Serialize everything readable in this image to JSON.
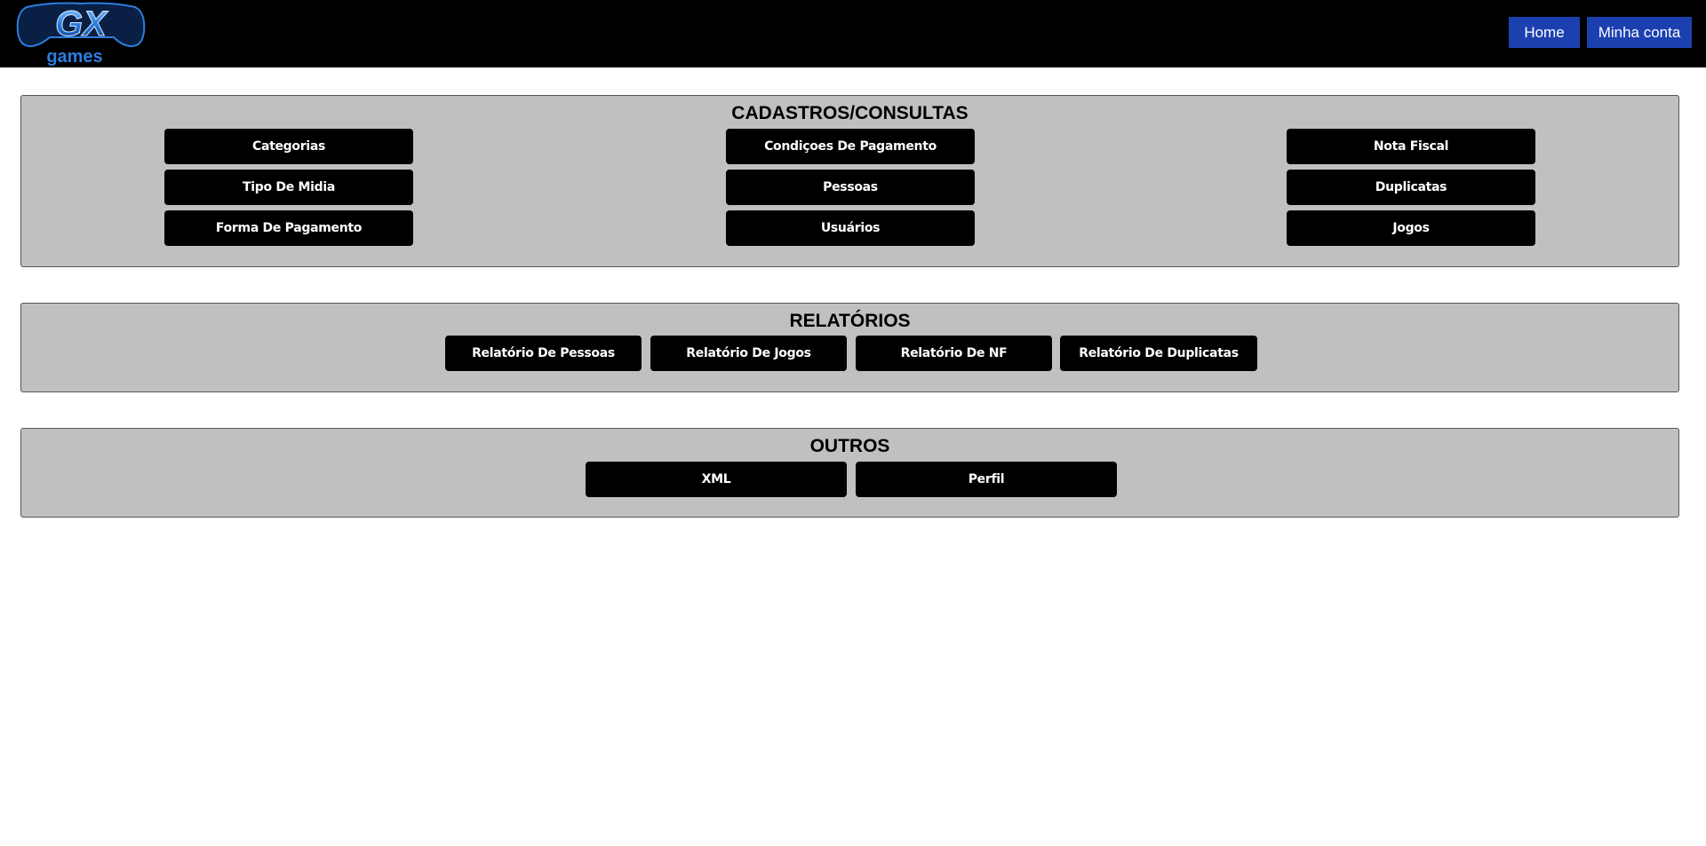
{
  "header": {
    "logo_text": "GX",
    "logo_subtext": "games",
    "nav": {
      "home_label": "Home",
      "account_label": "Minha conta"
    },
    "colors": {
      "bar": "#000000",
      "nav_button": "#1c40b0",
      "logo_accent": "#2b7de0"
    }
  },
  "sections": {
    "cadastros": {
      "title": "CADASTROS/CONSULTAS",
      "buttons": [
        "Categorias",
        "Condiçoes De Pagamento",
        "Nota Fiscal",
        "Tipo De Midia",
        "Pessoas",
        "Duplicatas",
        "Forma De Pagamento",
        "Usuários",
        "Jogos"
      ]
    },
    "relatorios": {
      "title": "RELATÓRIOS",
      "buttons": [
        "Relatório De Pessoas",
        "Relatório De Jogos",
        "Relatório De NF",
        "Relatório De Duplicatas"
      ]
    },
    "outros": {
      "title": "OUTROS",
      "buttons": [
        "XML",
        "Perfil"
      ]
    }
  },
  "colors": {
    "panel_bg": "#c0c0c0",
    "button_bg": "#000000",
    "button_text": "#ffffff"
  }
}
